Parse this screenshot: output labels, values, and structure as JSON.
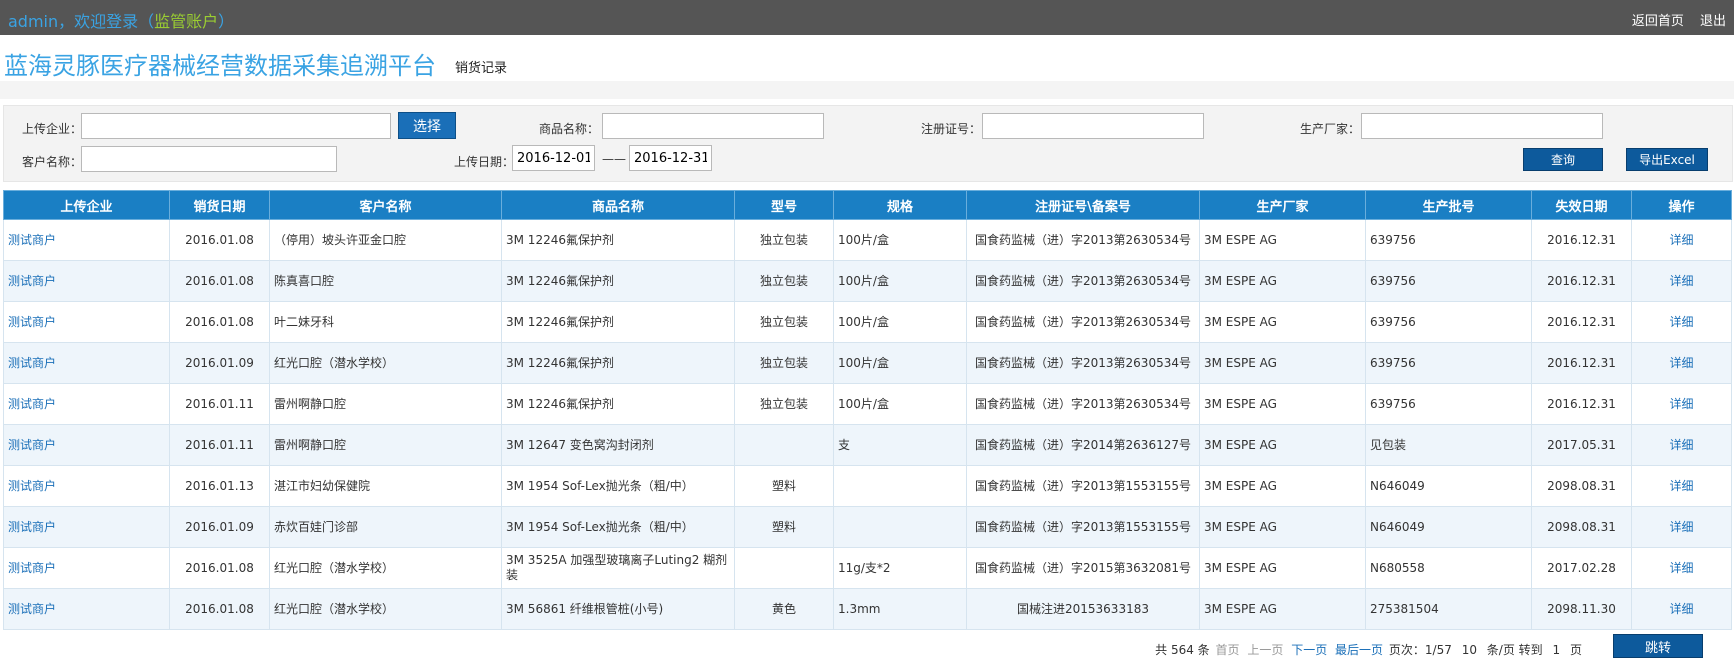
{
  "topbar": {
    "welcome": "admin，欢迎登录（",
    "account": "监管账户",
    "welcome_end": "）",
    "home_link": "返回首页",
    "logout_link": "退出"
  },
  "header": {
    "title": "蓝海灵豚医疗器械经营数据采集追溯平台",
    "subtitle": "销货记录"
  },
  "filters": {
    "upload_company_label": "上传企业：",
    "upload_company_value": "",
    "select_button": "选择",
    "product_name_label": "商品名称：",
    "product_name_value": "",
    "reg_no_label": "注册证号：",
    "reg_no_value": "",
    "manufacturer_label": "生产厂家：",
    "manufacturer_value": "",
    "customer_label": "客户名称：",
    "customer_value": "",
    "upload_date_label": "上传日期：",
    "date_from": "2016-12-01",
    "date_sep": "——",
    "date_to": "2016-12-31",
    "query_button": "查询",
    "export_button": "导出Excel"
  },
  "table": {
    "headers": [
      "上传企业",
      "销货日期",
      "客户名称",
      "商品名称",
      "型号",
      "规格",
      "注册证号\\备案号",
      "生产厂家",
      "生产批号",
      "失效日期",
      "操作"
    ],
    "rows": [
      [
        "测试商户",
        "2016.01.08",
        "（停用）坡头许亚金口腔",
        "3M 12246氟保护剂",
        "独立包装",
        "100片/盒",
        "国食药监械（进）字2013第2630534号",
        "3M ESPE AG",
        "639756",
        "2016.12.31",
        "详细"
      ],
      [
        "测试商户",
        "2016.01.08",
        "陈真喜口腔",
        "3M 12246氟保护剂",
        "独立包装",
        "100片/盒",
        "国食药监械（进）字2013第2630534号",
        "3M ESPE AG",
        "639756",
        "2016.12.31",
        "详细"
      ],
      [
        "测试商户",
        "2016.01.08",
        "叶二妹牙科",
        "3M 12246氟保护剂",
        "独立包装",
        "100片/盒",
        "国食药监械（进）字2013第2630534号",
        "3M ESPE AG",
        "639756",
        "2016.12.31",
        "详细"
      ],
      [
        "测试商户",
        "2016.01.09",
        "红光口腔（潜水学校）",
        "3M 12246氟保护剂",
        "独立包装",
        "100片/盒",
        "国食药监械（进）字2013第2630534号",
        "3M ESPE AG",
        "639756",
        "2016.12.31",
        "详细"
      ],
      [
        "测试商户",
        "2016.01.11",
        "雷州啊静口腔",
        "3M 12246氟保护剂",
        "独立包装",
        "100片/盒",
        "国食药监械（进）字2013第2630534号",
        "3M ESPE AG",
        "639756",
        "2016.12.31",
        "详细"
      ],
      [
        "测试商户",
        "2016.01.11",
        "雷州啊静口腔",
        "3M 12647 变色窝沟封闭剂",
        "",
        "支",
        "国食药监械（进）字2014第2636127号",
        "3M ESPE AG",
        "见包装",
        "2017.05.31",
        "详细"
      ],
      [
        "测试商户",
        "2016.01.13",
        "湛江市妇幼保健院",
        "3M 1954 Sof-Lex抛光条（粗/中）",
        "塑料",
        "",
        "国食药监械（进）字2013第1553155号",
        "3M ESPE AG",
        "N646049",
        "2098.08.31",
        "详细"
      ],
      [
        "测试商户",
        "2016.01.09",
        "赤炊百娃门诊部",
        "3M 1954 Sof-Lex抛光条（粗/中）",
        "塑料",
        "",
        "国食药监械（进）字2013第1553155号",
        "3M ESPE AG",
        "N646049",
        "2098.08.31",
        "详细"
      ],
      [
        "测试商户",
        "2016.01.08",
        "红光口腔（潜水学校）",
        "3M 3525A 加强型玻璃离子Luting2 糊剂装",
        "",
        "11g/支*2",
        "国食药监械（进）字2015第3632081号",
        "3M ESPE AG",
        "N680558",
        "2017.02.28",
        "详细"
      ],
      [
        "测试商户",
        "2016.01.08",
        "红光口腔（潜水学校）",
        "3M 56861 纤维根管桩(小号)",
        "黄色",
        "1.3mm",
        "国械注进20153633183",
        "3M ESPE AG",
        "275381504",
        "2098.11.30",
        "详细"
      ]
    ]
  },
  "pager": {
    "total_prefix": "共",
    "total": "564",
    "total_suffix": "条",
    "first": "首页",
    "prev": "上一页",
    "next": "下一页",
    "last": "最后一页",
    "page_label": "页次：",
    "page_info": "1/57",
    "per_page": "10",
    "per_page_suffix": "条/页",
    "goto_label": "转到",
    "goto_value": "1",
    "page_suffix": "页",
    "jump_button": "跳转"
  }
}
